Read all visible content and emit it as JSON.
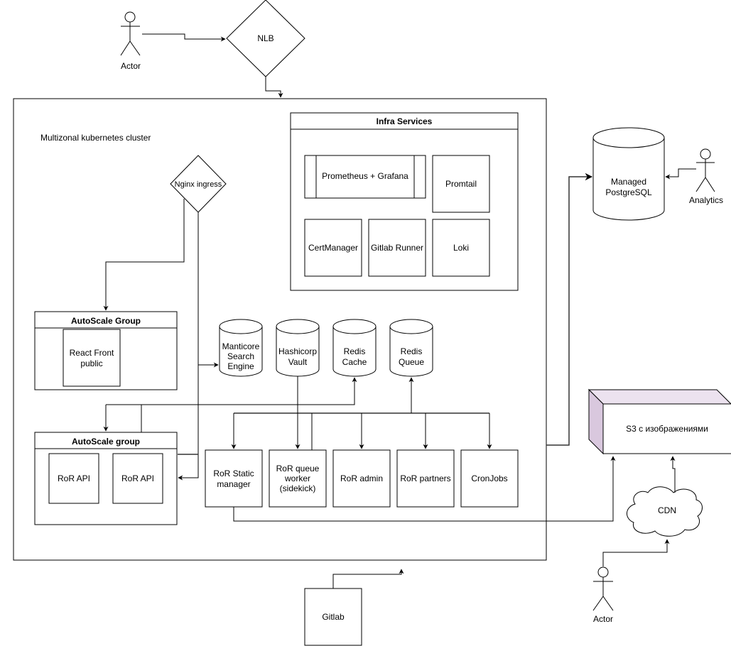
{
  "colors": {
    "s3_side": "#d9c8de",
    "s3_top": "#ece2ef",
    "stroke": "#000000"
  },
  "actors": {
    "top": "Actor",
    "analytics": "Analytics",
    "bottom": "Actor"
  },
  "nlb": "NLB",
  "cluster": {
    "label": "Multizonal kubernetes cluster"
  },
  "nginx": "Nginx ingress",
  "infra": {
    "title": "Infra Services",
    "items": [
      "Prometheus + Grafana",
      "Promtail",
      "CertManager",
      "Gitlab Runner",
      "Loki"
    ]
  },
  "asg_front": {
    "title": "AutoScale Group",
    "item": [
      "React Front",
      "public"
    ]
  },
  "asg_api": {
    "title": "AutoScale group",
    "items": [
      "RoR API",
      "RoR API"
    ]
  },
  "stores": {
    "manticore": [
      "Manticore",
      "Search",
      "Engine"
    ],
    "vault": [
      "Hashicorp",
      "Vault"
    ],
    "redis_cache": [
      "Redis",
      "Cache"
    ],
    "redis_queue": [
      "Redis",
      "Queue"
    ]
  },
  "services": {
    "static": [
      "RoR Static",
      "manager"
    ],
    "worker": [
      "RoR queue",
      "worker",
      "(sidekick)"
    ],
    "admin": "RoR admin",
    "partners": "RoR partners",
    "cron": "CronJobs"
  },
  "postgres": [
    "Managed",
    "PostgreSQL"
  ],
  "s3": "S3 с изображениями",
  "cdn": "CDN",
  "gitlab": "Gitlab"
}
